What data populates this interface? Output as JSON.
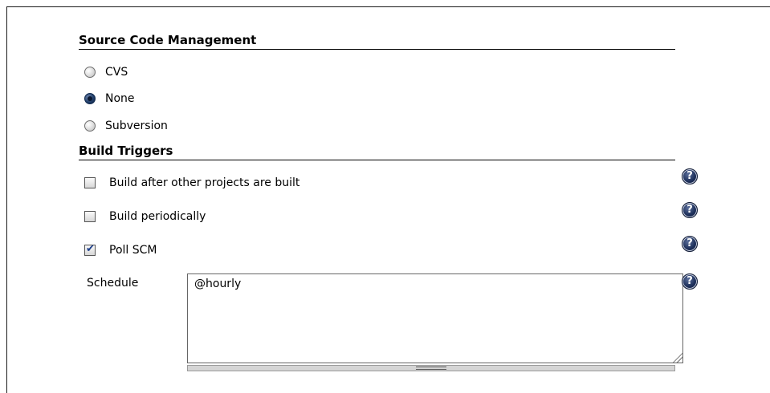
{
  "scm": {
    "title": "Source Code Management",
    "options": [
      {
        "label": "CVS",
        "selected": false
      },
      {
        "label": "None",
        "selected": true
      },
      {
        "label": "Subversion",
        "selected": false
      }
    ]
  },
  "triggers": {
    "title": "Build Triggers",
    "options": [
      {
        "label": "Build after other projects are built",
        "checked": false
      },
      {
        "label": "Build periodically",
        "checked": false
      },
      {
        "label": "Poll SCM",
        "checked": true
      }
    ],
    "schedule": {
      "label": "Schedule",
      "value": "@hourly"
    }
  },
  "help": {
    "glyph": "?"
  }
}
